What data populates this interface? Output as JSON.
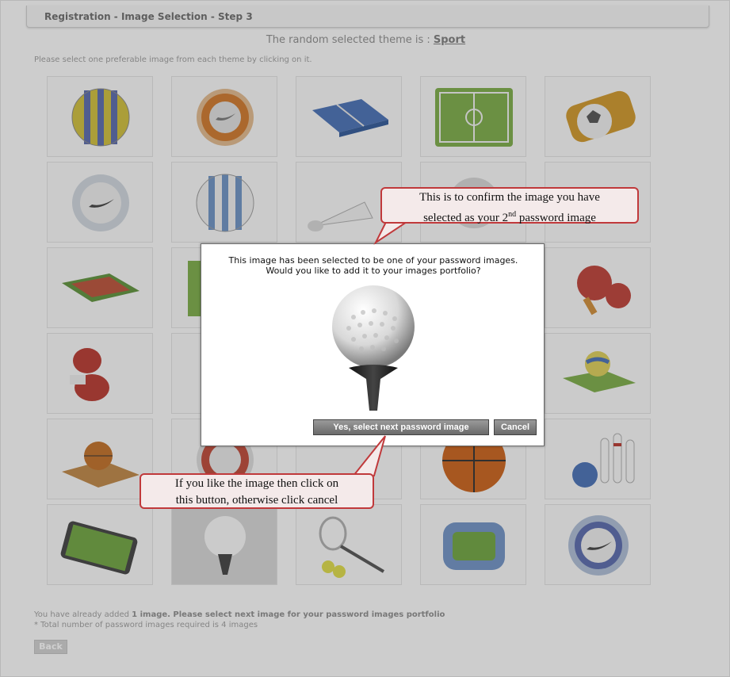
{
  "window": {
    "title": "Registration - Image Selection - Step 3"
  },
  "theme": {
    "prefix": "The random selected theme is : ",
    "name": "Sport"
  },
  "instructions": "Please select one preferable image from each theme by clicking on it.",
  "grid": {
    "rows": 6,
    "cols": 5,
    "images": [
      [
        "yellow-blue-soccer-ball",
        "nike-orange-ball",
        "tennis-court",
        "soccer-field",
        "ball-in-tin"
      ],
      [
        "nike-white-ball",
        "blue-white-ball",
        "shuttlecock",
        "volleyball",
        "sneaker"
      ],
      [
        "tennis-court-red",
        "soccer-field-side",
        "",
        "",
        "ping-pong-paddles"
      ],
      [
        "boxing-gloves",
        "",
        "",
        "",
        "volleyball-court"
      ],
      [
        "basketball-court",
        "nike-red-ball",
        "",
        "basketball",
        "bowling-pins"
      ],
      [
        "touch-screen-soccer",
        "golf-ball-selected",
        "tennis-racket",
        "stadium",
        "nike-blue-ball"
      ]
    ]
  },
  "dialog": {
    "message_line1": "This image has been selected to be one of your password images.",
    "message_line2": "Would you like to add it to your images portfolio?",
    "image": "golf-ball-on-tee",
    "yes_label": "Yes, select next password image",
    "cancel_label": "Cancel"
  },
  "callouts": {
    "top_line1": "This is to confirm the image you have",
    "top_line2_pre": "selected as your 2",
    "top_line2_sup": "nd",
    "top_line2_post": " password image",
    "bottom_line1": "If you like the image then click on",
    "bottom_line2": "this button, otherwise click cancel"
  },
  "footer": {
    "line1_pre": "You have already added ",
    "line1_bold": "1 image. Please select next image for your password images portfolio",
    "line2": "* Total number of password images required is 4 images",
    "back_label": "Back"
  },
  "colors": {
    "callout_border": "#c0393b",
    "callout_fill": "#f4eaea",
    "button_dark": "#6a6a6a"
  }
}
